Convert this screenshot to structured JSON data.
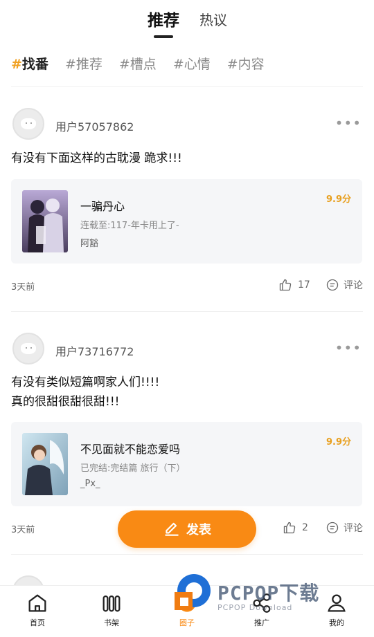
{
  "top_tabs": [
    {
      "label": "推荐",
      "active": true
    },
    {
      "label": "热议",
      "active": false
    }
  ],
  "tags": [
    {
      "label": "找番",
      "active": true
    },
    {
      "label": "推荐",
      "active": false
    },
    {
      "label": "槽点",
      "active": false
    },
    {
      "label": "心情",
      "active": false
    },
    {
      "label": "内容",
      "active": false
    }
  ],
  "posts": [
    {
      "username": "用户57057862",
      "content": "有没有下面这样的古耽漫 跪求!!!",
      "book": {
        "title": "一骗丹心",
        "subtitle": "连载至:117-年卡用上了-",
        "author": "阿豁",
        "score": "9.9分"
      },
      "time": "3天前",
      "likes": "17",
      "comment_label": "评论"
    },
    {
      "username": "用户73716772",
      "content": "有没有类似短篇啊家人们!!!!\n真的很甜很甜很甜!!!",
      "book": {
        "title": "不见面就不能恋爱吗",
        "subtitle": "已完结:完结篇 旅行（下）",
        "author": "_Px_",
        "score": "9.9分"
      },
      "time": "3天前",
      "likes": "2",
      "comment_label": "评论"
    }
  ],
  "publish_label": "发表",
  "nav": [
    {
      "label": "首页",
      "icon": "home-icon",
      "active": false
    },
    {
      "label": "书架",
      "icon": "bookshelf-icon",
      "active": false
    },
    {
      "label": "圈子",
      "icon": "circle-icon",
      "active": true
    },
    {
      "label": "推广",
      "icon": "share-icon",
      "active": false
    },
    {
      "label": "我的",
      "icon": "profile-icon",
      "active": false
    }
  ],
  "watermark": {
    "big": "PCPOP下载",
    "small": "PCPOP Download"
  },
  "colors": {
    "accent": "#f98a14",
    "score": "#e8a020",
    "card_bg": "#f5f6f8"
  }
}
